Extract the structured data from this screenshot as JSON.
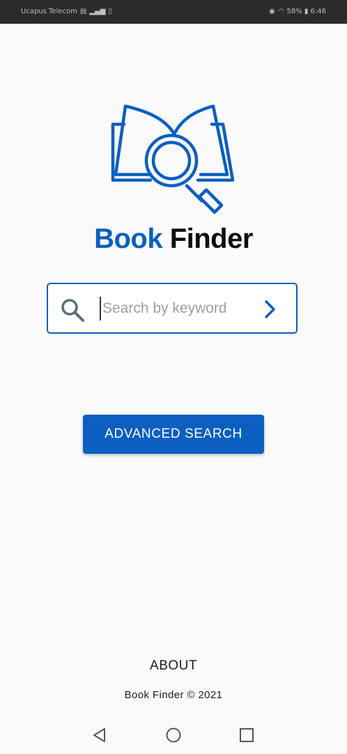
{
  "status_bar": {
    "carrier": "Ucapus Telecom",
    "right_text": "58% ▮ 6:46"
  },
  "app": {
    "title_part1": "Book",
    "title_part2": "Finder"
  },
  "search": {
    "placeholder": "Search by keyword",
    "value": ""
  },
  "advanced_search_label": "ADVANCED SEARCH",
  "footer": {
    "about_label": "ABOUT",
    "copyright": "Book Finder © 2021"
  },
  "colors": {
    "brand": "#0a5fc1",
    "background": "#fafafa",
    "icon_gray": "#546e7a"
  },
  "icons": {
    "logo": "book-magnifier-icon",
    "search": "search-icon",
    "go": "chevron-right-icon",
    "nav_back": "triangle-back-icon",
    "nav_home": "circle-home-icon",
    "nav_recent": "square-recent-icon"
  }
}
